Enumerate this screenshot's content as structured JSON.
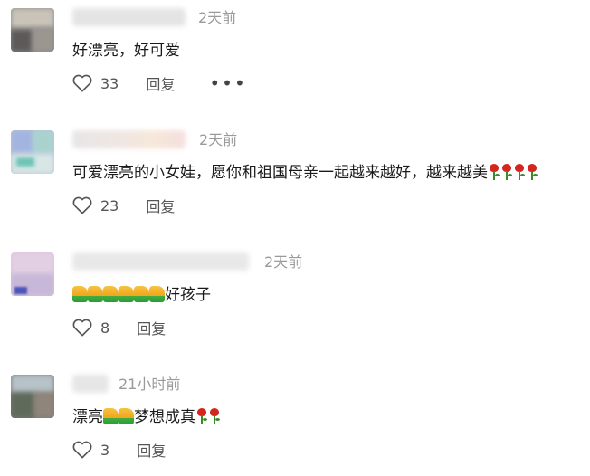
{
  "comments": [
    {
      "time": "2天前",
      "segments": [
        {
          "t": "text",
          "v": "好漂亮，好可爱"
        }
      ],
      "likes": "33",
      "reply": "回复",
      "more": "•••"
    },
    {
      "time": "2天前",
      "segments": [
        {
          "t": "text",
          "v": "可爱漂亮的小女娃，愿你和祖国母亲一起越来越好，越来越美"
        },
        {
          "t": "emoji",
          "v": "rose"
        },
        {
          "t": "emoji",
          "v": "rose"
        },
        {
          "t": "emoji",
          "v": "rose"
        },
        {
          "t": "emoji",
          "v": "rose"
        }
      ],
      "likes": "23",
      "reply": "回复"
    },
    {
      "time": "2天前",
      "segments": [
        {
          "t": "emoji",
          "v": "thumbs-up"
        },
        {
          "t": "emoji",
          "v": "thumbs-up"
        },
        {
          "t": "emoji",
          "v": "thumbs-up"
        },
        {
          "t": "emoji",
          "v": "thumbs-up"
        },
        {
          "t": "emoji",
          "v": "thumbs-up"
        },
        {
          "t": "emoji",
          "v": "thumbs-up"
        },
        {
          "t": "text",
          "v": "好孩子"
        }
      ],
      "likes": "8",
      "reply": "回复"
    },
    {
      "time": "21小时前",
      "segments": [
        {
          "t": "text",
          "v": "漂亮"
        },
        {
          "t": "emoji",
          "v": "thumbs-up"
        },
        {
          "t": "emoji",
          "v": "thumbs-up"
        },
        {
          "t": "text",
          "v": "梦想成真"
        },
        {
          "t": "emoji",
          "v": "rose"
        },
        {
          "t": "emoji",
          "v": "rose"
        }
      ],
      "likes": "3",
      "reply": "回复"
    }
  ]
}
